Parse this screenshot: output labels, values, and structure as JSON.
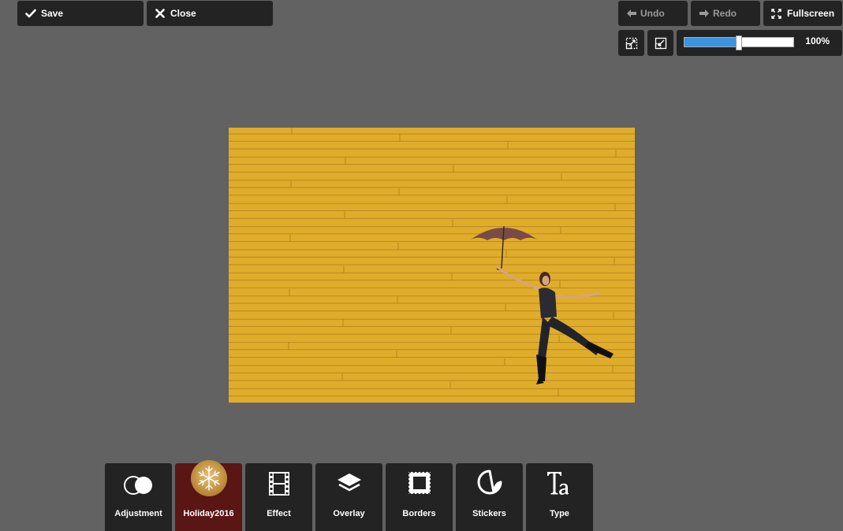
{
  "header": {
    "save_label": "Save",
    "close_label": "Close",
    "undo_label": "Undo",
    "redo_label": "Redo",
    "fullscreen_label": "Fullscreen"
  },
  "zoom": {
    "value_label": "100%",
    "slider_fraction": 0.5
  },
  "colors": {
    "background": "#626262",
    "button": "#232323",
    "accent": "#3b94e0",
    "active_tool": "#5a1515",
    "photo_wall": "#e0ac2c"
  },
  "canvas": {
    "subject": "woman-with-umbrella-on-yellow-wall-photo"
  },
  "tools": [
    {
      "label": "Adjustment",
      "icon": "adjustment-circles-icon"
    },
    {
      "label": "Holiday2016",
      "icon": "snowflake-ornament-icon",
      "active": true
    },
    {
      "label": "Effect",
      "icon": "film-strip-icon"
    },
    {
      "label": "Overlay",
      "icon": "layers-icon"
    },
    {
      "label": "Borders",
      "icon": "stamp-border-icon"
    },
    {
      "label": "Stickers",
      "icon": "sticker-icon"
    },
    {
      "label": "Type",
      "icon": "type-icon"
    }
  ]
}
